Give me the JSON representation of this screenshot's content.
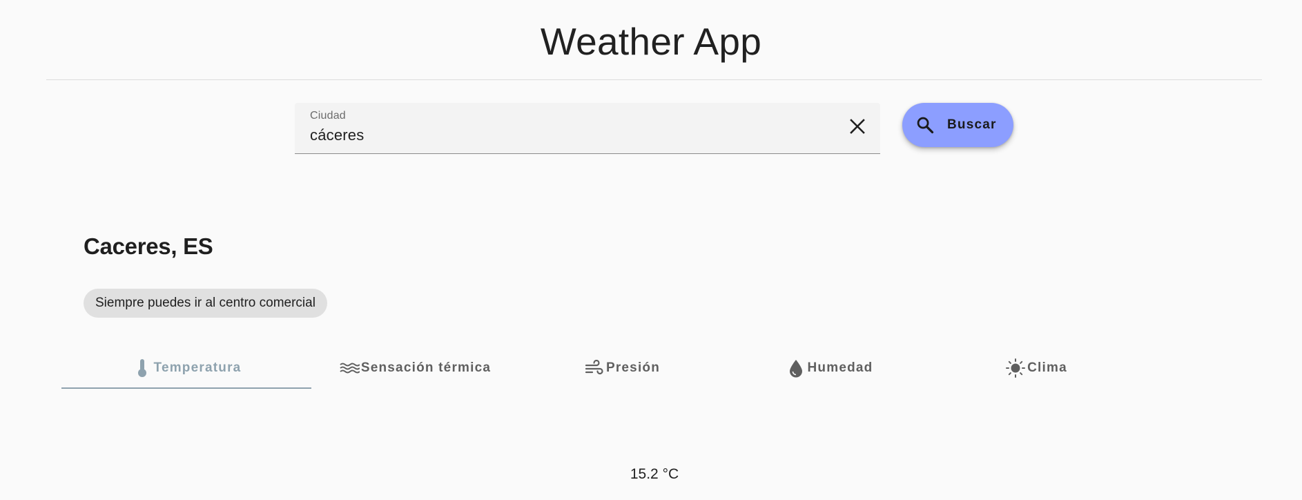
{
  "header": {
    "title": "Weather App"
  },
  "search": {
    "label": "Ciudad",
    "value": "cáceres",
    "clear_icon": "close-icon",
    "button_label": "Buscar",
    "button_icon": "search-icon"
  },
  "location": {
    "name": "Caceres, ES",
    "advice": "Siempre puedes ir al centro comercial"
  },
  "tabs": [
    {
      "label": "Temperatura",
      "icon": "thermometer-icon",
      "active": true
    },
    {
      "label": "Sensación térmica",
      "icon": "waves-icon",
      "active": false
    },
    {
      "label": "Presión",
      "icon": "wind-icon",
      "active": false
    },
    {
      "label": "Humedad",
      "icon": "water-drop-icon",
      "active": false
    },
    {
      "label": "Clima",
      "icon": "sun-icon",
      "active": false
    }
  ],
  "readout": {
    "value": "15.2 °C"
  },
  "colors": {
    "accent": "#8c9eff",
    "active_tab": "#8ea2ae",
    "background": "#fafafa",
    "chip": "#e0e0e0"
  }
}
